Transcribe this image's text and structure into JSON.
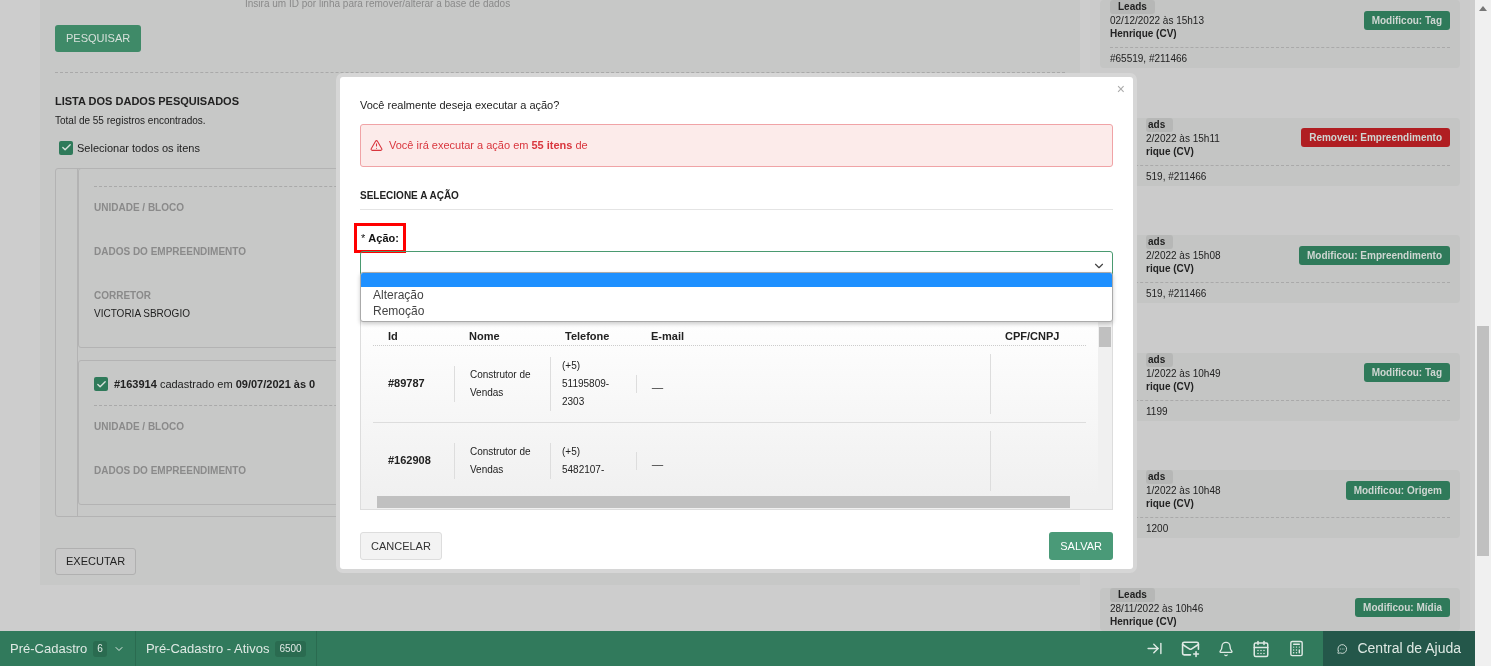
{
  "page": {
    "hint": "Insira um ID por linha para remover/alterar a base de dados",
    "search_button": "PESQUISAR",
    "list_title": "LISTA DOS DADOS PESQUISADOS",
    "total": "Total de 55 registros encontrados.",
    "select_all": {
      "label": "Selecionar todos os itens",
      "checked": true
    },
    "records": [
      {
        "fields": [
          {
            "label": "UNIDADE / BLOCO"
          },
          {
            "label": "DADOS DO EMPREENDIMENTO"
          },
          {
            "label": "CORRETOR",
            "value": "VICTORIA SBROGIO"
          }
        ]
      },
      {
        "header": "**#163914** cadastrado em **09/07/2021 às 0**",
        "checked": true,
        "fields": [
          {
            "label": "UNIDADE / BLOCO"
          },
          {
            "label": "DADOS DO EMPREENDIMENTO"
          }
        ]
      }
    ],
    "execute_button": "EXECUTAR"
  },
  "activity": [
    {
      "kind": "full",
      "module": "Leads",
      "datetime": "02/12/2022 às 15h13",
      "user": "Henrique (CV)",
      "badge": "Modificou: Tag",
      "color": "#2f7a5a",
      "ids": "#65519, #211466"
    },
    {
      "kind": "covered",
      "module": "ads",
      "datetime": "2/2022 às 15h11",
      "user": "rique (CV)",
      "badge": "Removeu: Empreendimento",
      "color": "#b01e22",
      "ids": "519, #211466"
    },
    {
      "kind": "covered",
      "module": "ads",
      "datetime": "2/2022 às 15h08",
      "user": "rique (CV)",
      "badge": "Modificou: Empreendimento",
      "color": "#2f7a5a",
      "ids": "519, #211466"
    },
    {
      "kind": "covered",
      "module": "ads",
      "datetime": "1/2022 às 10h49",
      "user": "rique (CV)",
      "badge": "Modificou: Tag",
      "color": "#2f7a5a",
      "ids": "1199"
    },
    {
      "kind": "covered",
      "module": "ads",
      "datetime": "1/2022 às 10h48",
      "user": "rique (CV)",
      "badge": "Modificou: Origem",
      "color": "#2f7a5a",
      "ids": "1200"
    },
    {
      "kind": "full",
      "module": "Leads",
      "datetime": "28/11/2022 às 10h46",
      "user": "Henrique (CV)",
      "badge": "Modificou: Mídia",
      "color": "#2f7a5a"
    }
  ],
  "dialog": {
    "close": "×",
    "question": "Você realmente deseja executar a ação?",
    "alert": "Você irá executar a ação em **55 itens** de",
    "section": "SELECIONE A AÇÃO",
    "field": {
      "label": "* **Ação:**",
      "empty_option": {
        "selected": true
      },
      "options": [
        {
          "label": "Alteração",
          "selected": false
        },
        {
          "label": "Remoção",
          "selected": false
        }
      ]
    },
    "table": {
      "columns": [
        "Id",
        "Nome",
        "Telefone",
        "E-mail",
        "CPF/CNPJ"
      ],
      "rows": [
        {
          "id": "#89787",
          "name": "Construtor de Vendas",
          "phone": "(+5) 51195809-2303",
          "email": "__"
        },
        {
          "id": "#162908",
          "name": "Construtor de Vendas",
          "phone": "(+5) 5482107-",
          "email": "__"
        }
      ]
    },
    "buttons": {
      "cancel": "CANCELAR",
      "save": "SALVAR"
    }
  },
  "bottom_bar": {
    "tabs": [
      {
        "label": "Pré-Cadastro",
        "count": "6",
        "dropdown": true
      },
      {
        "label": "Pré-Cadastro - Ativos",
        "count": "6500",
        "dropdown": false
      }
    ],
    "help": "Central de Ajuda"
  }
}
